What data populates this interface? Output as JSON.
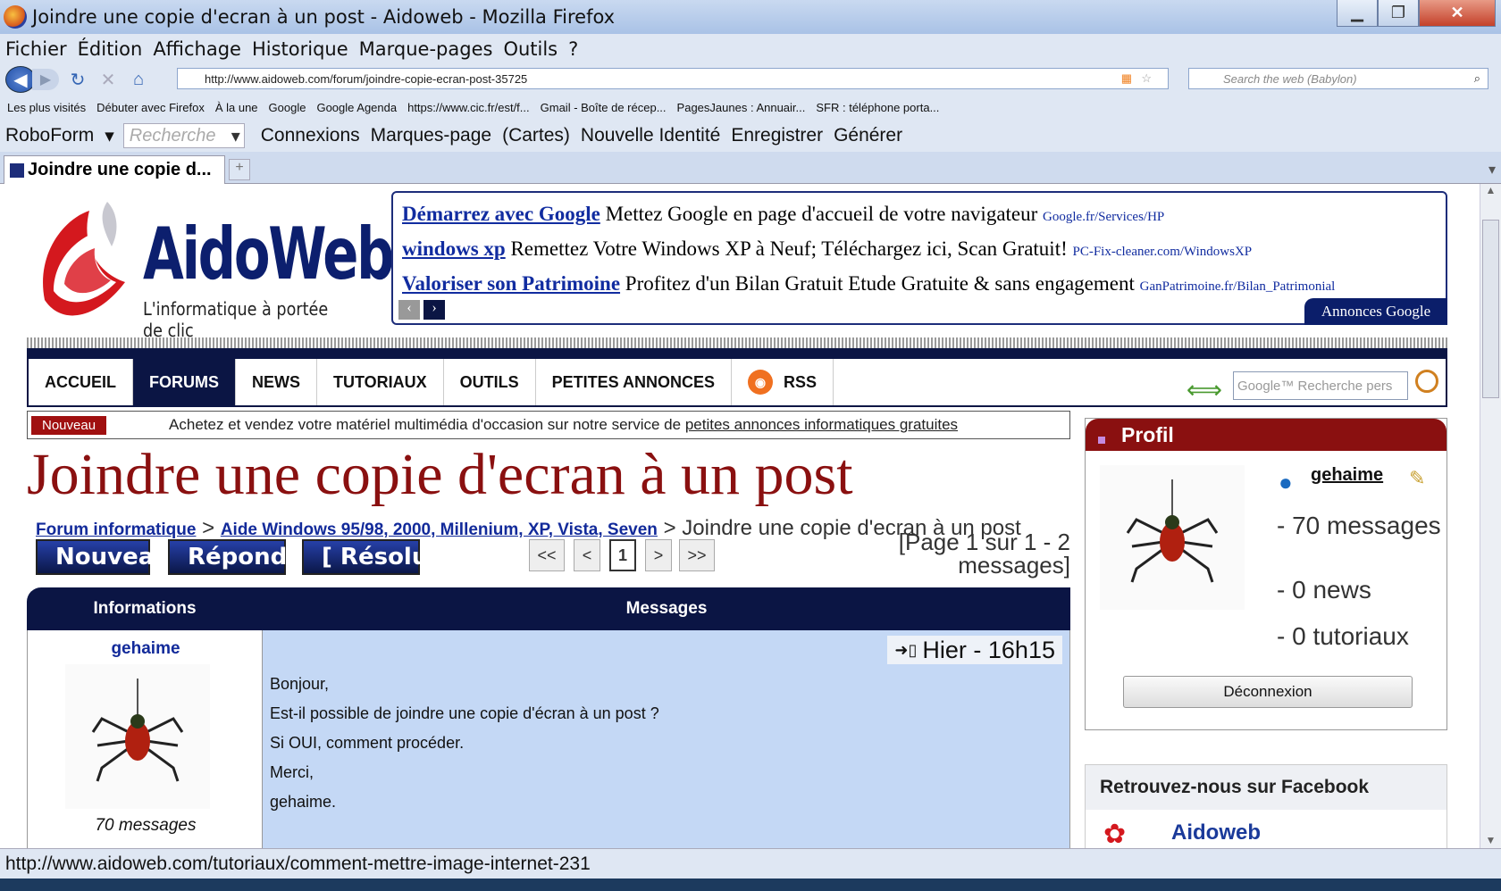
{
  "window": {
    "title": "Joindre une copie d'ecran à un post - Aidoweb - Mozilla Firefox"
  },
  "menu": [
    "Fichier",
    "Édition",
    "Affichage",
    "Historique",
    "Marque-pages",
    "Outils",
    "?"
  ],
  "nav": {
    "url": "http://www.aidoweb.com/forum/joindre-copie-ecran-post-35725",
    "search_placeholder": "Search the web (Babylon)"
  },
  "bookmarks": [
    "Les plus visités",
    "Débuter avec Firefox",
    "À la une",
    "Google",
    "Google Agenda",
    "https://www.cic.fr/est/f...",
    "Gmail - Boîte de récep...",
    "PagesJaunes : Annuair...",
    "SFR : téléphone porta..."
  ],
  "roboform": {
    "name": "RoboForm",
    "search": "Recherche",
    "items": [
      "Connexions",
      "Marques-page",
      "(Cartes)",
      "Nouvelle Identité",
      "Enregistrer",
      "Générer"
    ]
  },
  "tab": {
    "label": "Joindre une copie d...",
    "new": "+"
  },
  "site": {
    "logo_text": "AidoWeb",
    "tagline": "L'informatique à portée de clic",
    "ads": [
      {
        "title": "Démarrez avec Google",
        "text": "Mettez Google en page d'accueil de votre navigateur",
        "url": "Google.fr/Services/HP"
      },
      {
        "title": "windows xp",
        "text": "Remettez Votre Windows XP à Neuf; Téléchargez ici, Scan Gratuit!",
        "url": "PC-Fix-cleaner.com/WindowsXP"
      },
      {
        "title": "Valoriser son Patrimoine",
        "text": "Profitez d'un Bilan Gratuit Etude Gratuite & sans engagement",
        "url": "GanPatrimoine.fr/Bilan_Patrimonial"
      }
    ],
    "ads_label": "Annonces Google",
    "nav_items": [
      "ACCUEIL",
      "FORUMS",
      "NEWS",
      "TUTORIAUX",
      "OUTILS",
      "PETITES ANNONCES",
      "RSS"
    ],
    "nav_search_placeholder": "Google™ Recherche pers",
    "promo": {
      "badge": "Nouveau",
      "text": "Achetez et vendez votre matériel multimédia d'occasion sur notre service de",
      "link": "petites annonces informatiques gratuites"
    },
    "heading": "Joindre une copie d'ecran à un post",
    "breadcrumb": {
      "forum": "Forum informatique",
      "category": "Aide Windows 95/98, 2000, Millenium, XP, Vista, Seven",
      "current": "> Joindre une copie d'ecran à un post",
      "sep": ">"
    },
    "post_buttons": [
      "Nouveau",
      "Répondre",
      "[ Résolu ]"
    ],
    "pagination": [
      "<<",
      "<",
      "1",
      ">",
      ">>"
    ],
    "page_info": "[Page 1 sur 1 - 2 messages]",
    "table": {
      "col_info": "Informations",
      "col_messages": "Messages"
    },
    "post": {
      "author": "gehaime",
      "author_count": "70 messages",
      "time": "Hier - 16h15",
      "lines": [
        "Bonjour,",
        "Est-il possible de joindre une copie d'écran à un post ?",
        "Si OUI, comment procéder.",
        "Merci,",
        "gehaime."
      ]
    },
    "profil": {
      "title": "Profil",
      "user": "gehaime",
      "stats": [
        "- 70 messages",
        "- 0 news",
        "- 0 tutoriaux"
      ],
      "logout": "Déconnexion"
    },
    "facebook": {
      "title": "Retrouvez-nous sur Facebook",
      "name": "Aidoweb"
    }
  },
  "status": "http://www.aidoweb.com/tutoriaux/comment-mettre-image-internet-231",
  "colors": {
    "brand_dark": "#0b1544",
    "brand_red": "#8a1010",
    "post_bg": "#c4d8f5"
  }
}
